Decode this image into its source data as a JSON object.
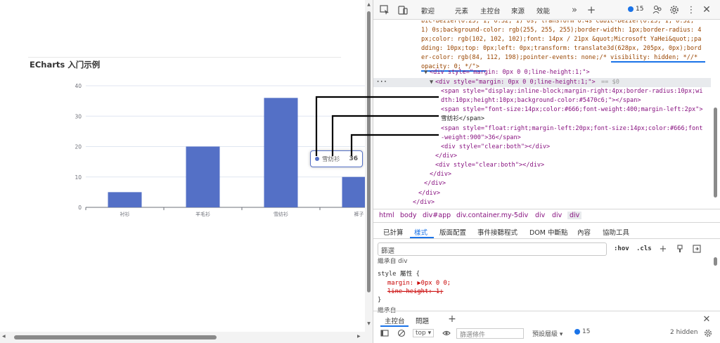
{
  "page": {
    "title": "ECharts 入门示例"
  },
  "chart_data": {
    "type": "bar",
    "categories": [
      "衬衫",
      "羊毛衫",
      "雪纺衫",
      "裤子"
    ],
    "values": [
      5,
      20,
      36,
      10
    ],
    "ylim": [
      0,
      40
    ],
    "yticks": [
      0,
      10,
      20,
      30,
      40
    ],
    "grid": true,
    "color": "#5470c6"
  },
  "tooltip": {
    "name": "雪纺衫",
    "value": "36",
    "color": "#5470c6"
  },
  "devtools": {
    "tabs": [
      "歡迎",
      "元素",
      "主控台",
      "來源",
      "效能"
    ],
    "issues_count": "15",
    "code_lines": [
      "bic-bezier(0.23, 1, 0.32, 1) 0s, transform 0.4s cubic-bezier(0.23, 1, 0.32,",
      "1) 0s;background-color: rgb(255, 255, 255);border-width: 1px;border-radius: 4",
      "px;color: rgb(102, 102, 102);font: 14px / 21px &quot;Microsoft YaHei&quot;;pa",
      "dding: 10px;top: 0px;left: 0px;transform: translate3d(628px, 205px, 0px);bord",
      "er-color: rgb(84, 112, 198);pointer-events: none;/* visibility: hidden; *//*",
      "opacity: 0; */\">",
      "<div style=\"margin: 0px 0 0;line-height:1;\">",
      "<div style=\"margin: 0px 0 0;line-height:1;\">",
      "== $0",
      "<span style=\"display:inline-block;margin-right:4px;border-radius:10px;wi",
      "dth:10px;height:10px;background-color:#5470c6;\"></span>",
      "<span style=\"font-size:14px;color:#666;font-weight:400;margin-left:2px\">",
      "雪纺衫</span>",
      "<span style=\"float:right;margin-left:20px;font-size:14px;color:#666;font",
      "-weight:900\">36</span>",
      "<div style=\"clear:both\"></div>",
      "</div>",
      "<div style=\"clear:both\"></div>",
      "</div>",
      "</div>",
      "</div>",
      "</div>"
    ],
    "breadcrumb": [
      "html",
      "body",
      "div#app",
      "div.container.my-5",
      "div",
      "div",
      "div",
      "div"
    ],
    "subtabs": [
      "已計算",
      "樣式",
      "版面配置",
      "事件接聽程式",
      "DOM 中斷點",
      "內容",
      "協助工具"
    ],
    "filter_placeholder": "篩選",
    "filter_tools": [
      ":hov",
      ".cls"
    ],
    "styles": {
      "inherited": "繼承自 div",
      "rule_header": "style 屬性 {",
      "prop1": "margin: ▶0px 0 0;",
      "prop2": "line-height: 1;",
      "close": "}",
      "next": "繼承自"
    },
    "drawer_tabs": [
      "主控台",
      "問題"
    ],
    "console": {
      "context": "top",
      "filter_placeholder": "篩選條件",
      "level": "預設層級",
      "issues": "15",
      "hidden": "2 hidden"
    }
  }
}
